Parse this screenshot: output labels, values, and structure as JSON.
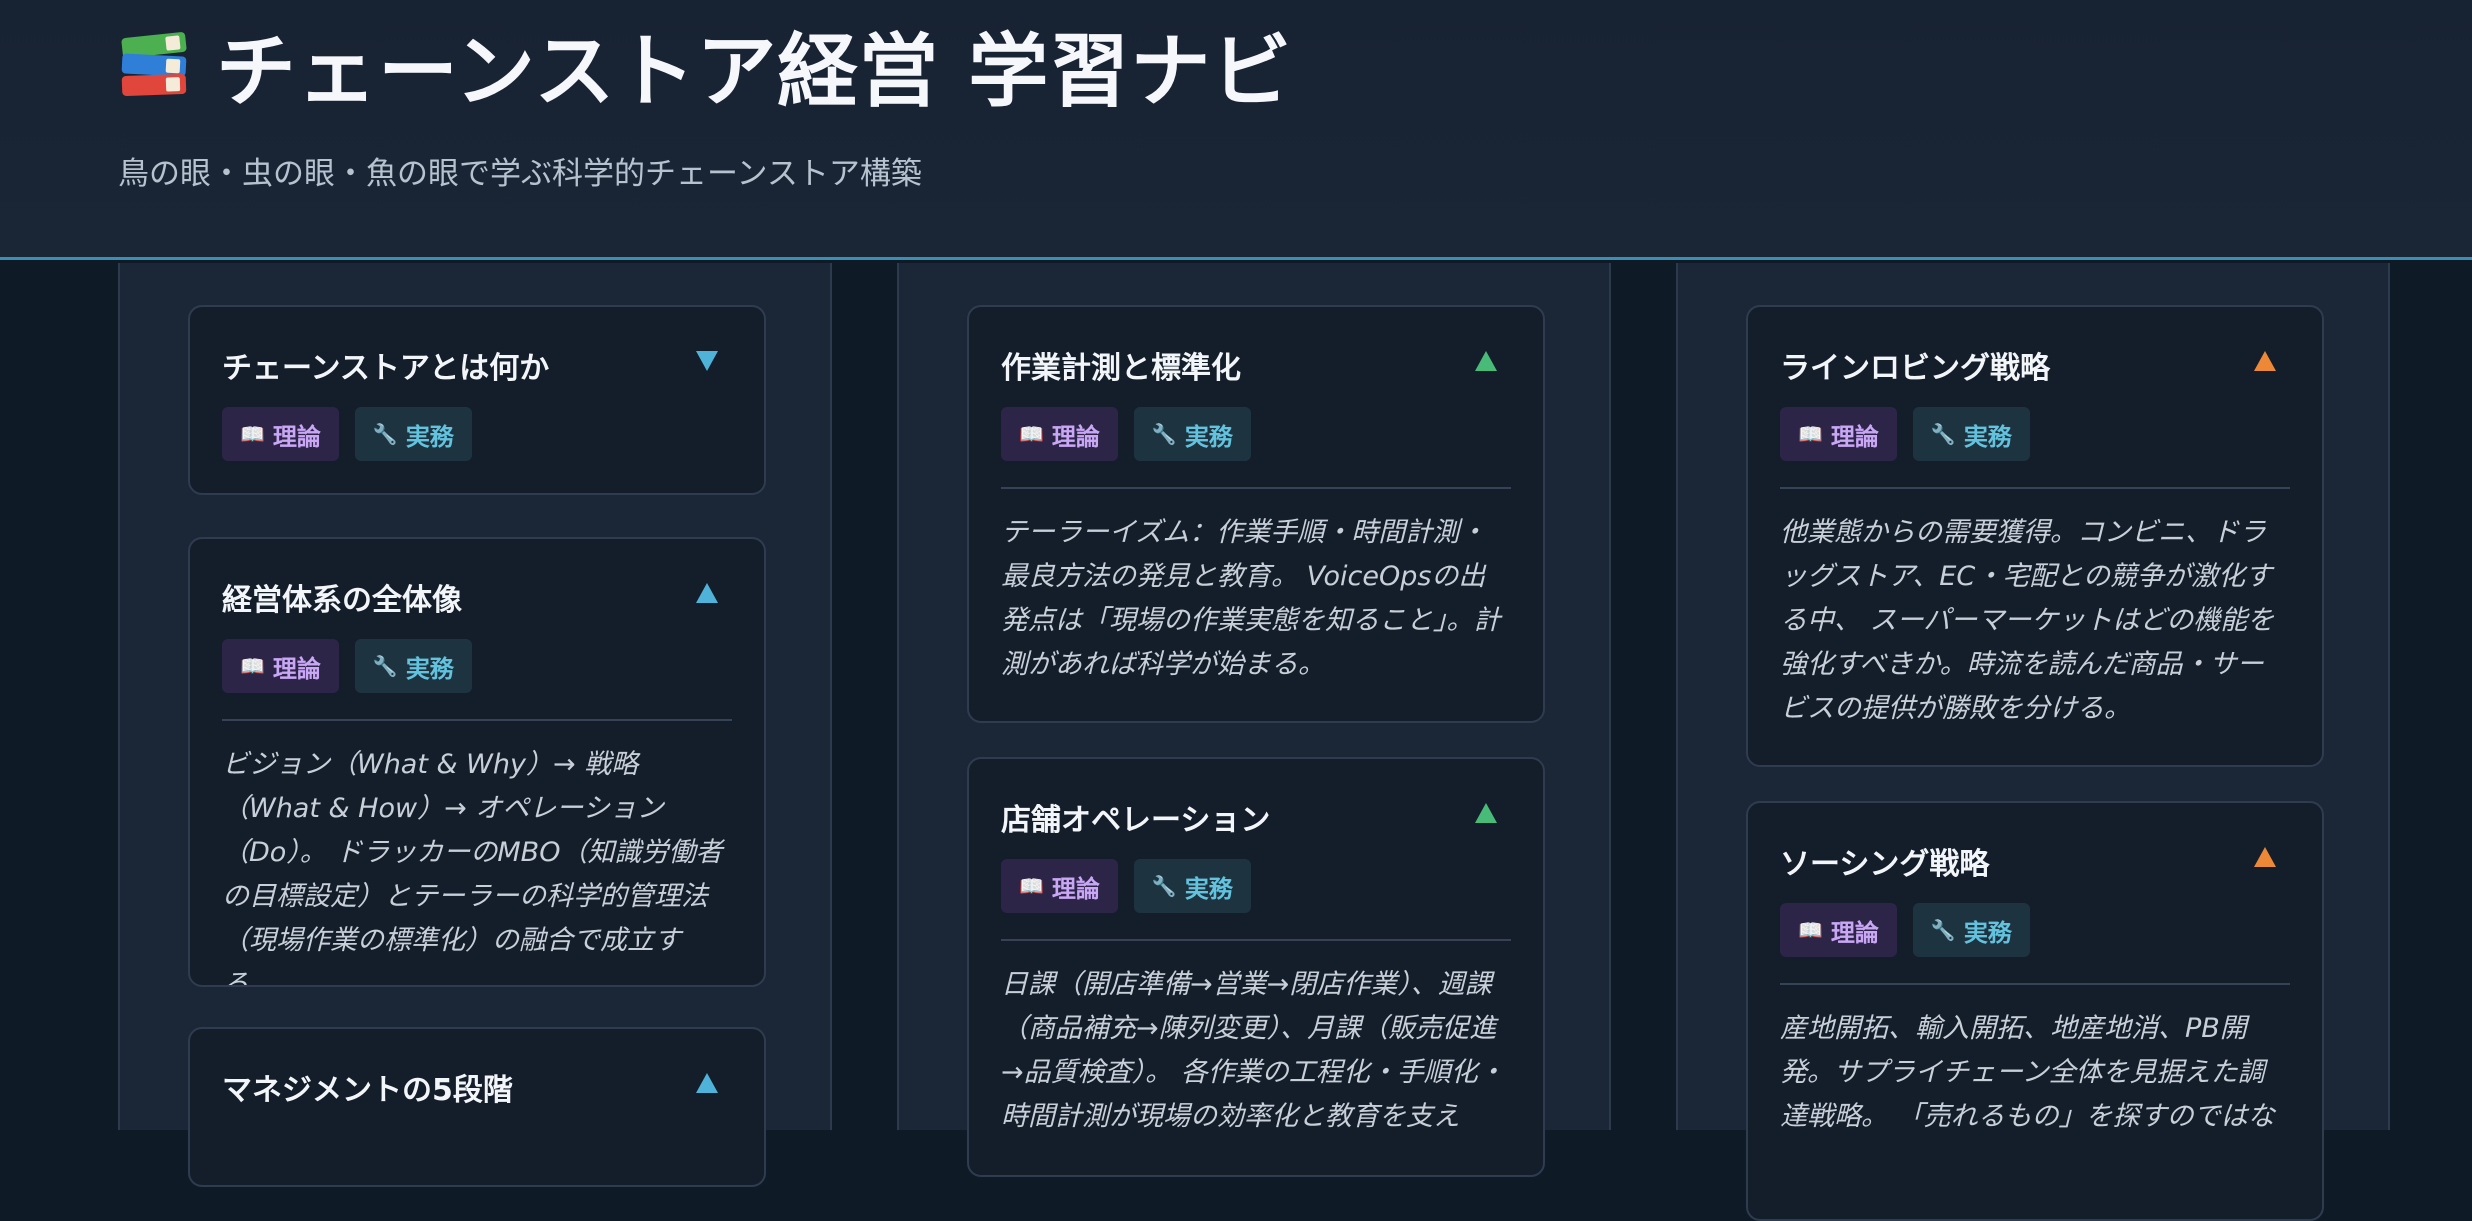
{
  "header": {
    "title": "チェーンストア経営 学習ナビ",
    "subtitle": "鳥の眼・虫の眼・魚の眼で学ぶ科学的チェーンストア構築",
    "icon": "books-icon"
  },
  "tags": {
    "theory_label": "理論",
    "practice_label": "実務",
    "theory_icon": "📖",
    "practice_icon": "🔧"
  },
  "colors": {
    "accent_blue": "#4fb3d9",
    "accent_green": "#48bb78",
    "accent_orange": "#ed8936"
  },
  "columns": [
    {
      "cards": [
        {
          "title": "チェーンストアとは何か",
          "toggle": "collapsed",
          "body": ""
        },
        {
          "title": "経営体系の全体像",
          "toggle": "expanded",
          "body": "ビジョン（What & Why）→ 戦略（What & How）→ オペレーション（Do）。 ドラッカーのMBO（知識労働者の目標設定）とテーラーの科学的管理法（現場作業の標準化）の融合で成立する。"
        },
        {
          "title": "マネジメントの5段階",
          "toggle": "expanded",
          "body": ""
        }
      ]
    },
    {
      "cards": [
        {
          "title": "作業計測と標準化",
          "toggle": "expanded",
          "body": "テーラーイズム：作業手順・時間計測・最良方法の発見と教育。 VoiceOpsの出発点は「現場の作業実態を知ること」。計測があれば科学が始まる。"
        },
        {
          "title": "店舗オペレーション",
          "toggle": "expanded",
          "body": "日課（開店準備→営業→閉店作業）、週課（商品補充→陳列変更）、月課（販売促進→品質検査）。 各作業の工程化・手順化・時間計測が現場の効率化と教育を支え"
        }
      ]
    },
    {
      "cards": [
        {
          "title": "ラインロビング戦略",
          "toggle": "expanded",
          "body": "他業態からの需要獲得。コンビニ、ドラッグストア、EC・宅配との競争が激化する中、 スーパーマーケットはどの機能を強化すべきか。時流を読んだ商品・サービスの提供が勝敗を分ける。"
        },
        {
          "title": "ソーシング戦略",
          "toggle": "expanded",
          "body": "産地開拓、輸入開拓、地産地消、PB開発。サプライチェーン全体を見据えた調達戦略。 「売れるもの」を探すのではな"
        }
      ]
    }
  ]
}
